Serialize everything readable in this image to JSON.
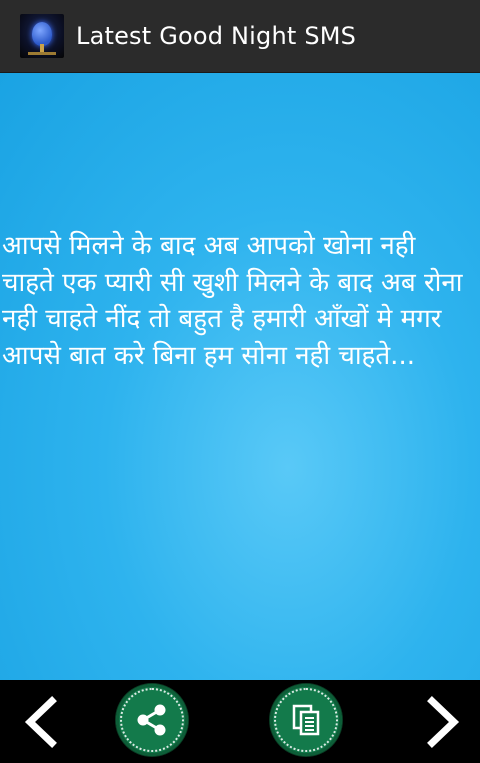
{
  "app_bar": {
    "title": "Latest Good Night SMS",
    "icon": "app-logo-icon"
  },
  "message": {
    "text": " आपसे मिलने के बाद अब आपको खोना नही चाहते एक प्यारी सी खुशी मिलने के बाद अब रोना नही चाहते नींद तो बहुत है हमारी आँखों मे मगर आपसे बात करे बिना हम सोना नही चाहते..."
  },
  "bottom_bar": {
    "prev_icon": "chevron-left-icon",
    "share_icon": "share-icon",
    "copy_icon": "copy-icon",
    "next_icon": "chevron-right-icon"
  },
  "colors": {
    "app_bar_bg": "#2b2b2b",
    "content_bg": "#2eb3ee",
    "button_green": "#137a4b",
    "bottom_bar_bg": "#000000"
  }
}
